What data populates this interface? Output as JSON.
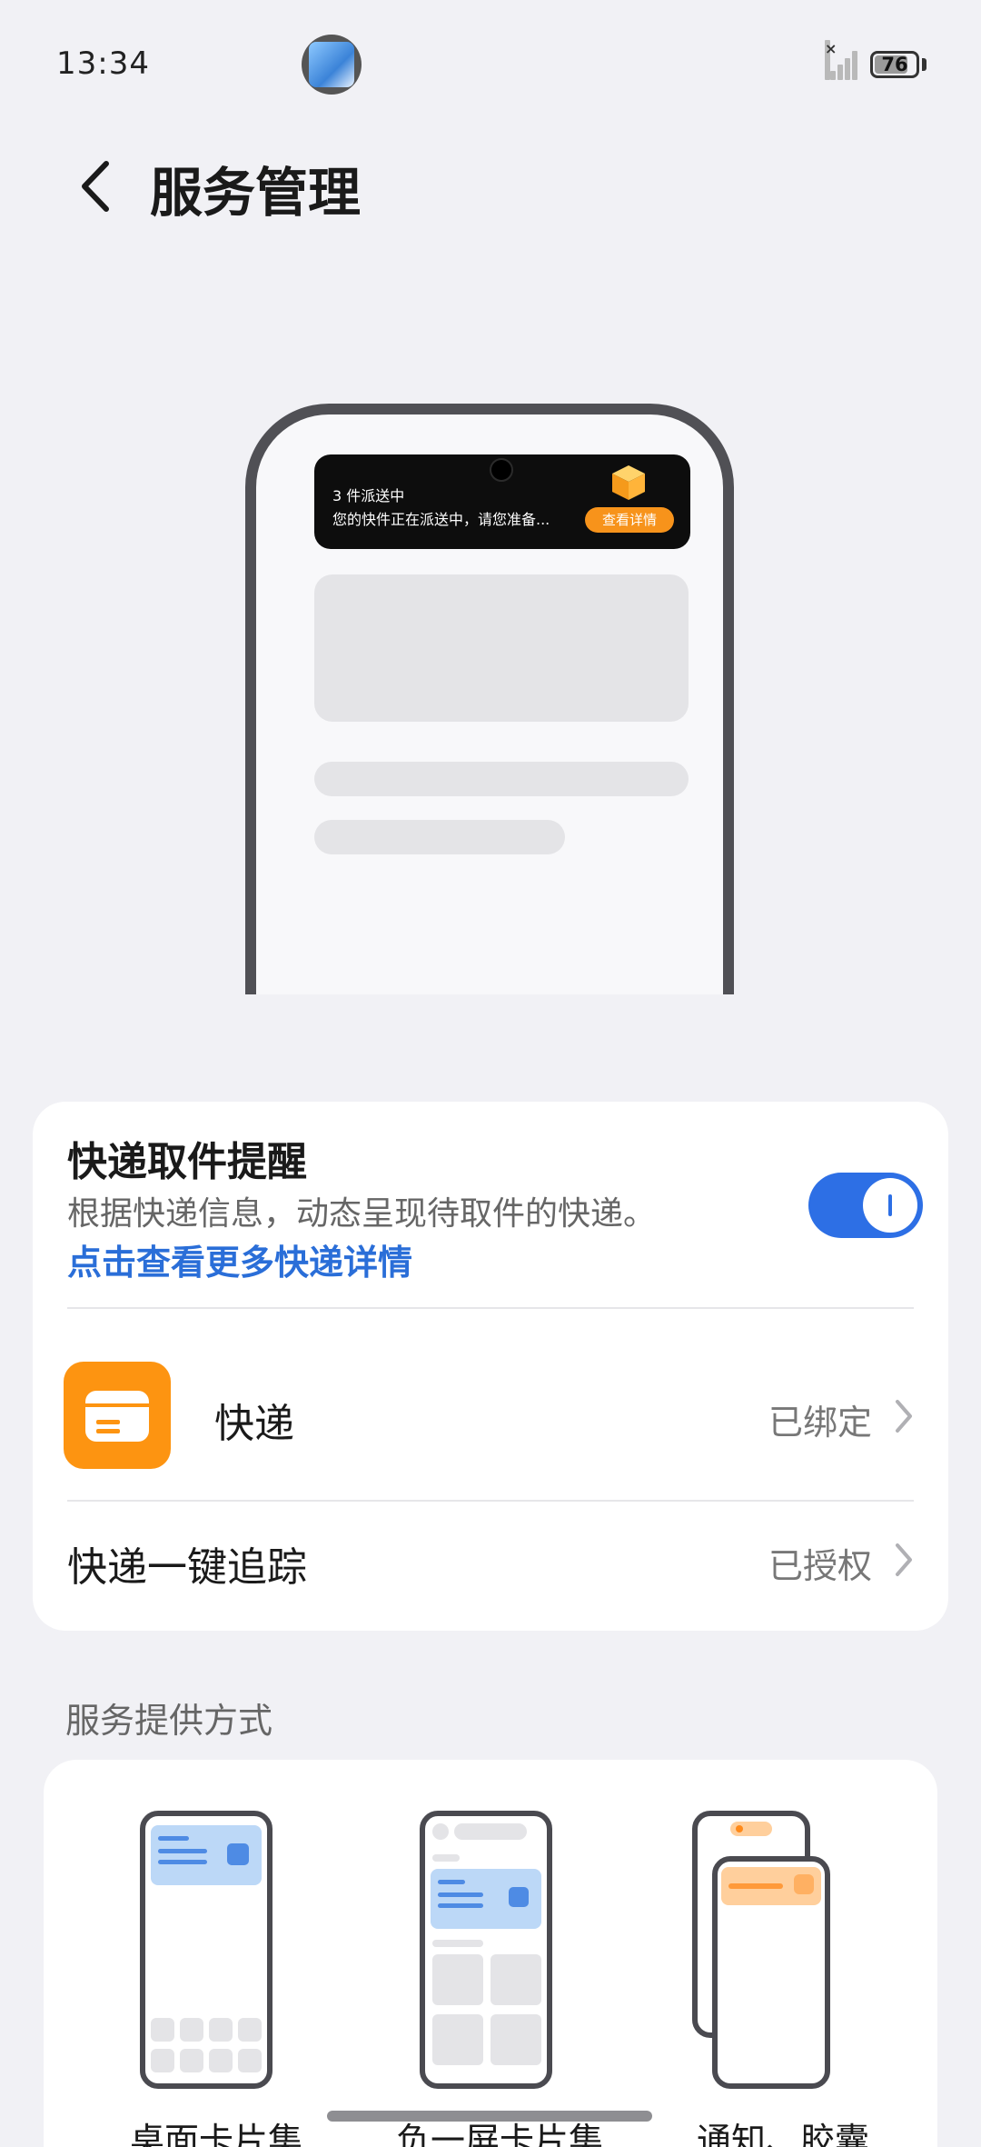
{
  "status_bar": {
    "time": "13:34",
    "battery": "76",
    "icons": [
      "app-icon",
      "signal-icon",
      "battery-icon"
    ]
  },
  "header": {
    "title": "服务管理",
    "back_icon": "chevron-left-icon"
  },
  "preview": {
    "notification_title": "3 件派送中",
    "notification_text": "您的快件正在派送中，请您准备...",
    "notification_button": "查看详情"
  },
  "reminder": {
    "title": "快递取件提醒",
    "description": "根据快递信息，动态呈现待取件的快递。",
    "link": "点击查看更多快递详情",
    "enabled": true
  },
  "services": [
    {
      "label": "快递",
      "status": "已绑定",
      "icon": "package-icon"
    },
    {
      "label": "快递一键追踪",
      "status": "已授权"
    }
  ],
  "modes_section": {
    "title": "服务提供方式",
    "modes": [
      "桌面卡片集",
      "负一屏卡片集",
      "通知、胶囊"
    ]
  },
  "colors": {
    "accent": "#2d6fe5",
    "link": "#2a6ed8",
    "express": "#fd9411"
  }
}
